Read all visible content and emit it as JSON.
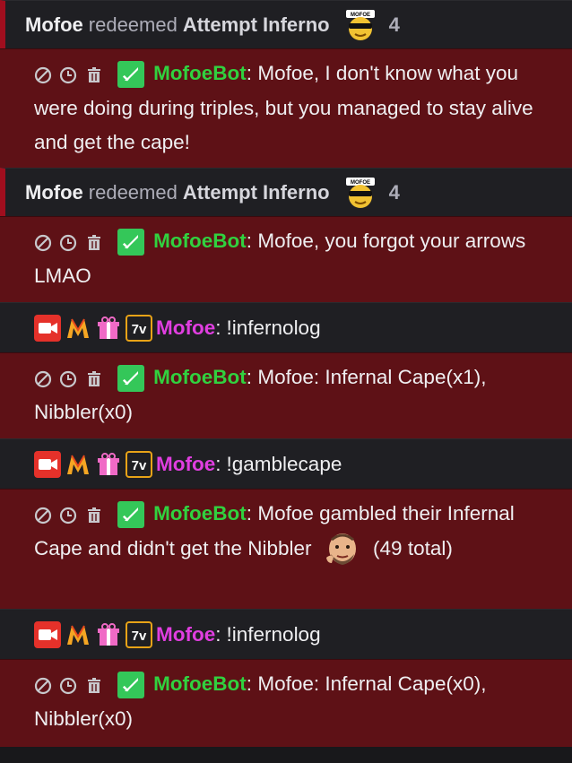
{
  "redemptions": [
    {
      "user": "Mofoe",
      "verb": "redeemed",
      "reward": "Attempt Inferno",
      "emote": "mofoe-sunglasses-emote",
      "emote_text": "MOFOE",
      "cost": "4"
    },
    {
      "user": "Mofoe",
      "verb": "redeemed",
      "reward": "Attempt Inferno",
      "emote": "mofoe-sunglasses-emote",
      "emote_text": "MOFOE",
      "cost": "4"
    }
  ],
  "bot": {
    "name": "MofoeBot",
    "colon": ":",
    "badge_icon": "sword-icon"
  },
  "viewer": {
    "name": "Mofoe",
    "colon": ":",
    "badges": [
      "camera-icon",
      "m-logo-icon",
      "gift-icon",
      "7tv-icon"
    ]
  },
  "messages": [
    {
      "text": "Mofoe, I don't know what you were doing during triples, but you managed to stay alive and get the cape!"
    },
    {
      "text": "Mofoe, you forgot your arrows LMAO"
    },
    {
      "text": "!infernolog"
    },
    {
      "text": "Mofoe: Infernal Cape(x1), Nibbler(x0)"
    },
    {
      "text": "!gamblecape"
    },
    {
      "text_before": "Mofoe gambled their Infernal Cape and didn't get the Nibbler",
      "emote": "man-face-emote",
      "text_after": "(49 total)"
    },
    {
      "text": "!infernolog"
    },
    {
      "text": "Mofoe: Infernal Cape(x0), Nibbler(x0)"
    }
  ],
  "colors": {
    "bot_bg": "#5e1116",
    "dark_bg": "#1f1f23",
    "bot_name": "#31d13f",
    "viewer_name": "#e03ee0",
    "redeem_accent": "#a00e1e"
  }
}
